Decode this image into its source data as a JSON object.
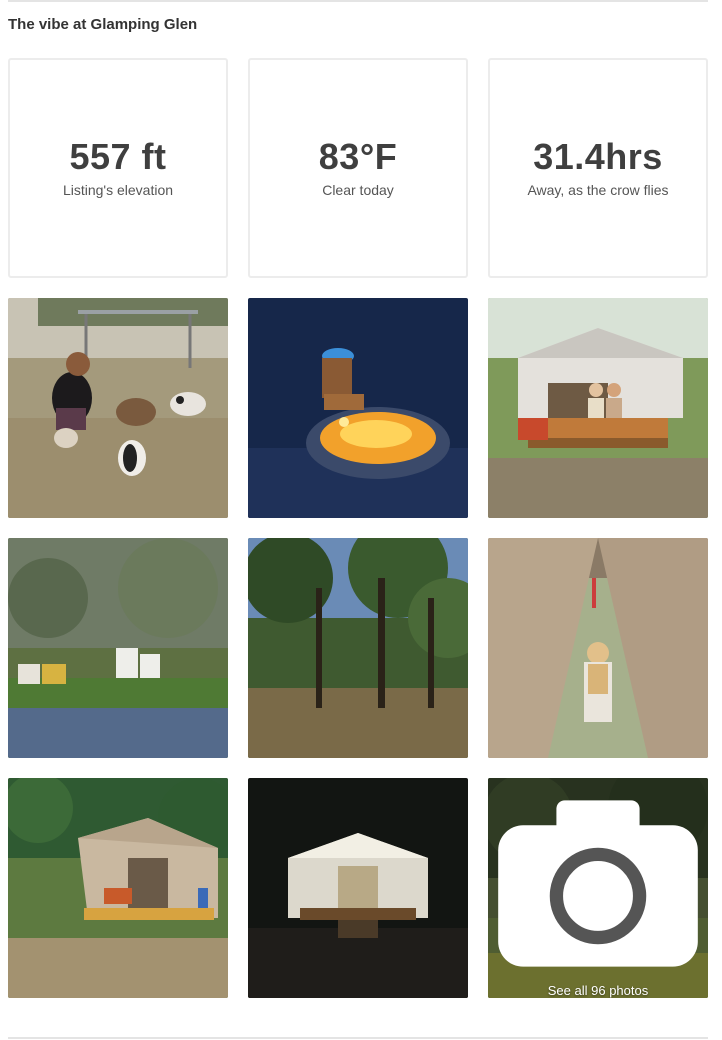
{
  "section": {
    "title": "The vibe at Glamping Glen"
  },
  "stats": [
    {
      "value": "557 ft",
      "label": "Listing's elevation"
    },
    {
      "value": "83°F",
      "label": "Clear today"
    },
    {
      "value": "31.4hrs",
      "label": "Away, as the crow flies"
    }
  ],
  "photos": [
    {
      "subject": "woman feeding goats"
    },
    {
      "subject": "campfire at night"
    },
    {
      "subject": "couple on tent deck"
    },
    {
      "subject": "beehives in bluebonnets"
    },
    {
      "subject": "oak woodland"
    },
    {
      "subject": "woman in tent doorway"
    },
    {
      "subject": "tent in meadow"
    },
    {
      "subject": "tent lit at night"
    },
    {
      "subject": "wildflower field"
    }
  ],
  "see_all": {
    "label": "See all 96 photos",
    "icon": "camera-icon"
  }
}
